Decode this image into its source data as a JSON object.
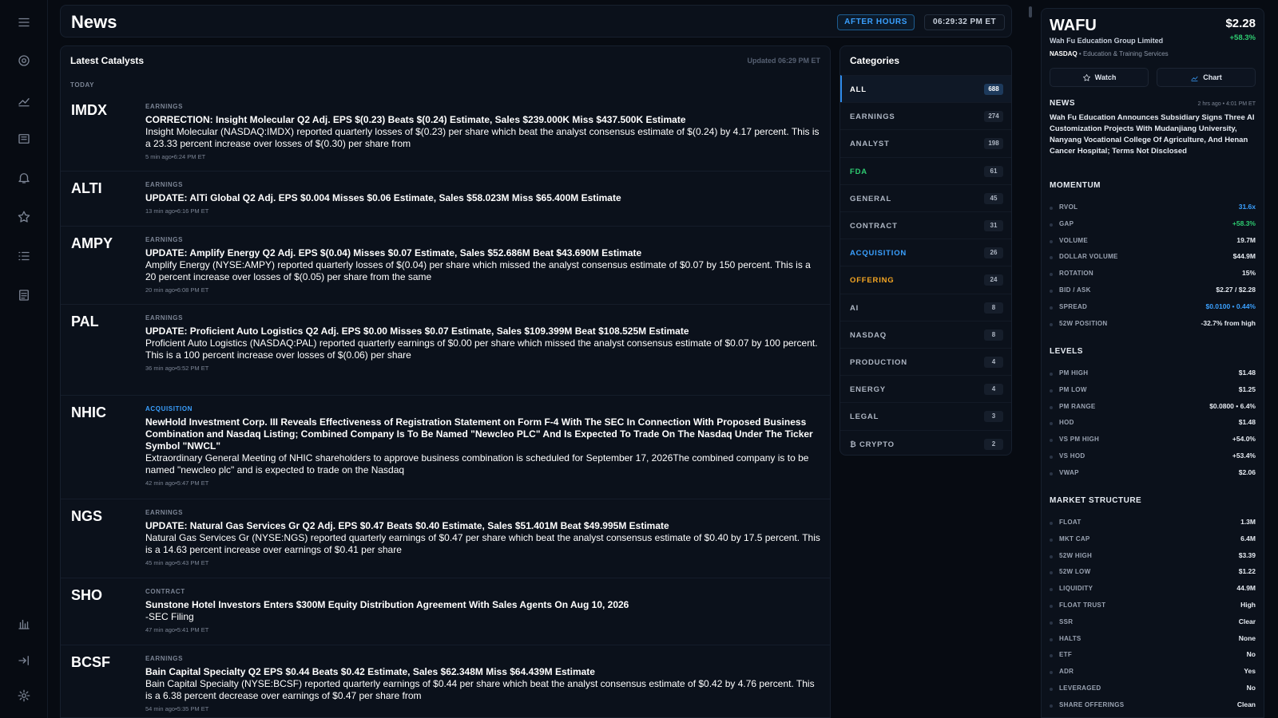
{
  "header": {
    "title": "News",
    "session": "AFTER HOURS",
    "clock": "06:29:32 PM ET"
  },
  "rail_icons": [
    "menu-icon",
    "target-icon",
    "trend-icon",
    "news-icon",
    "bell-icon",
    "star-icon",
    "list-icon",
    "notes-icon",
    "chart-icon",
    "collapse-icon",
    "gear-icon"
  ],
  "feed": {
    "title": "Latest Catalysts",
    "updated": "Updated 06:29 PM ET",
    "day_label": "TODAY",
    "stories": [
      {
        "ticker": "IMDX",
        "category": "EARNINGS",
        "headline": "CORRECTION: Insight Molecular Q2 Adj. EPS $(0.23) Beats $(0.24) Estimate, Sales $239.000K Miss $437.500K Estimate",
        "summary": "Insight Molecular (NASDAQ:IMDX) reported quarterly losses of $(0.23) per share which beat the analyst consensus estimate of $(0.24) by 4.17 percent. This is a 23.33 percent increase over losses of $(0.30) per share from",
        "time": "5 min ago•6:24 PM ET"
      },
      {
        "ticker": "ALTI",
        "category": "EARNINGS",
        "headline": "UPDATE: AlTi Global Q2 Adj. EPS $0.004 Misses $0.06 Estimate, Sales $58.023M Miss $65.400M Estimate",
        "summary": "",
        "time": "13 min ago•6:16 PM ET"
      },
      {
        "ticker": "AMPY",
        "category": "EARNINGS",
        "headline": "UPDATE: Amplify Energy Q2 Adj. EPS $(0.04) Misses $0.07 Estimate, Sales $52.686M Beat $43.690M Estimate",
        "summary": "Amplify Energy (NYSE:AMPY) reported quarterly losses of $(0.04) per share which missed the analyst consensus estimate of $0.07 by 150 percent. This is a 20 percent increase over losses of $(0.05) per share from the same",
        "time": "20 min ago•6:08 PM ET"
      },
      {
        "ticker": "PAL",
        "category": "EARNINGS",
        "headline": "UPDATE: Proficient Auto Logistics Q2 Adj. EPS $0.00 Misses $0.07 Estimate, Sales $109.399M Beat $108.525M Estimate",
        "summary": "Proficient Auto Logistics (NASDAQ:PAL) reported quarterly earnings of $0.00 per share which missed the analyst consensus estimate of $0.07 by 100 percent. This is a 100 percent increase over losses of $(0.06) per share",
        "time": "36 min ago•5:52 PM ET"
      },
      {
        "ticker": "NHIC",
        "category": "ACQUISITION",
        "headline": "NewHold Investment Corp. III Reveals Effectiveness of Registration Statement on Form F-4 With The SEC In Connection With Proposed Business Combination and Nasdaq Listing; Combined Company Is To Be Named \"Newcleo PLC\" And Is Expected To Trade On The Nasdaq Under The Ticker Symbol \"NWCL\"",
        "summary": "Extraordinary General Meeting of NHIC shareholders to approve business combination is scheduled for September 17, 2026The combined company is to be named \"newcleo plc\" and is expected to trade on the Nasdaq",
        "time": "42 min ago•5:47 PM ET"
      },
      {
        "ticker": "NGS",
        "category": "EARNINGS",
        "headline": "UPDATE: Natural Gas Services Gr Q2 Adj. EPS $0.47 Beats $0.40 Estimate, Sales $51.401M Beat $49.995M Estimate",
        "summary": "Natural Gas Services Gr (NYSE:NGS) reported quarterly earnings of $0.47 per share which beat the analyst consensus estimate of $0.40 by 17.5 percent. This is a 14.63 percent increase over earnings of $0.41 per share",
        "time": "45 min ago•5:43 PM ET"
      },
      {
        "ticker": "SHO",
        "category": "CONTRACT",
        "headline": "Sunstone Hotel Investors Enters $300M Equity Distribution Agreement With Sales Agents On Aug 10, 2026",
        "summary": "-SEC Filing",
        "time": "47 min ago•5:41 PM ET"
      },
      {
        "ticker": "BCSF",
        "category": "EARNINGS",
        "headline": "Bain Capital Specialty Q2 EPS $0.44 Beats $0.42 Estimate, Sales $62.348M Miss $64.439M Estimate",
        "summary": "Bain Capital Specialty (NYSE:BCSF) reported quarterly earnings of $0.44 per share which beat the analyst consensus estimate of $0.42 by 4.76 percent. This is a 6.38 percent decrease over earnings of $0.47 per share from",
        "time": "54 min ago•5:35 PM ET"
      }
    ]
  },
  "categories": {
    "title": "Categories",
    "items": [
      {
        "label": "ALL",
        "count": "688",
        "color": "#ffffff",
        "active": true
      },
      {
        "label": "EARNINGS",
        "count": "274",
        "color": "#aeb6c3"
      },
      {
        "label": "ANALYST",
        "count": "198",
        "color": "#aeb6c3"
      },
      {
        "label": "FDA",
        "count": "61",
        "color": "#2ecc71"
      },
      {
        "label": "GENERAL",
        "count": "45",
        "color": "#aeb6c3"
      },
      {
        "label": "CONTRACT",
        "count": "31",
        "color": "#aeb6c3"
      },
      {
        "label": "ACQUISITION",
        "count": "26",
        "color": "#3aa0ff"
      },
      {
        "label": "OFFERING",
        "count": "24",
        "color": "#f5a623"
      },
      {
        "label": "AI",
        "count": "8",
        "color": "#aeb6c3"
      },
      {
        "label": "NASDAQ",
        "count": "8",
        "color": "#aeb6c3"
      },
      {
        "label": "PRODUCTION",
        "count": "4",
        "color": "#aeb6c3"
      },
      {
        "label": "ENERGY",
        "count": "4",
        "color": "#aeb6c3"
      },
      {
        "label": "LEGAL",
        "count": "3",
        "color": "#aeb6c3"
      },
      {
        "label": "₿ CRYPTO",
        "count": "2",
        "color": "#aeb6c3"
      }
    ]
  },
  "ticker": {
    "symbol": "WAFU",
    "company": "Wah Fu Education Group Limited",
    "exchange": "NASDAQ",
    "sector": "Education & Training Services",
    "price": "$2.28",
    "change": "+58.3%",
    "watch_label": "Watch",
    "chart_label": "Chart",
    "news_title": "NEWS",
    "news_meta": "2 hrs ago • 4:01 PM ET",
    "news_text": "Wah Fu Education Announces Subsidiary Signs Three AI Customization Projects With Mudanjiang University, Nanyang Vocational College Of Agriculture, And Henan Cancer Hospital; Terms Not Disclosed",
    "momentum_title": "MOMENTUM",
    "momentum": [
      {
        "label": "RVOL",
        "value": "31.6x",
        "tone": "blue"
      },
      {
        "label": "GAP",
        "value": "+58.3%",
        "tone": "green"
      },
      {
        "label": "VOLUME",
        "value": "19.7M",
        "tone": ""
      },
      {
        "label": "DOLLAR VOLUME",
        "value": "$44.9M",
        "tone": ""
      },
      {
        "label": "ROTATION",
        "value": "15%",
        "tone": ""
      },
      {
        "label": "BID / ASK",
        "value": "$2.27 / $2.28",
        "tone": ""
      },
      {
        "label": "SPREAD",
        "value": "$0.0100 • 0.44%",
        "tone": "blue"
      },
      {
        "label": "52W POSITION",
        "value": "-32.7% from high",
        "tone": ""
      }
    ],
    "levels_title": "LEVELS",
    "levels": [
      {
        "label": "PM HIGH",
        "value": "$1.48",
        "tone": ""
      },
      {
        "label": "PM LOW",
        "value": "$1.25",
        "tone": ""
      },
      {
        "label": "PM RANGE",
        "value": "$0.0800 • 6.4%",
        "tone": ""
      },
      {
        "label": "HOD",
        "value": "$1.48",
        "tone": ""
      },
      {
        "label": "VS PM HIGH",
        "value": "+54.0%",
        "tone": ""
      },
      {
        "label": "VS HOD",
        "value": "+53.4%",
        "tone": ""
      },
      {
        "label": "VWAP",
        "value": "$2.06",
        "tone": ""
      }
    ],
    "structure_title": "MARKET STRUCTURE",
    "structure": [
      {
        "label": "FLOAT",
        "value": "1.3M",
        "tone": ""
      },
      {
        "label": "MKT CAP",
        "value": "6.4M",
        "tone": ""
      },
      {
        "label": "52W HIGH",
        "value": "$3.39",
        "tone": ""
      },
      {
        "label": "52W LOW",
        "value": "$1.22",
        "tone": ""
      },
      {
        "label": "LIQUIDITY",
        "value": "44.9M",
        "tone": ""
      },
      {
        "label": "FLOAT TRUST",
        "value": "High",
        "tone": ""
      },
      {
        "label": "SSR",
        "value": "Clear",
        "tone": ""
      },
      {
        "label": "HALTS",
        "value": "None",
        "tone": ""
      },
      {
        "label": "ETF",
        "value": "No",
        "tone": ""
      },
      {
        "label": "ADR",
        "value": "Yes",
        "tone": ""
      },
      {
        "label": "LEVERAGED",
        "value": "No",
        "tone": ""
      },
      {
        "label": "SHARE OFFERINGS",
        "value": "Clean",
        "tone": ""
      }
    ]
  }
}
